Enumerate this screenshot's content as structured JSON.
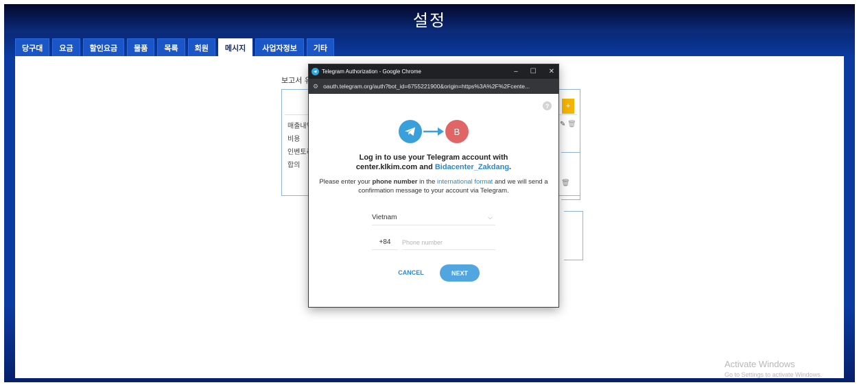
{
  "app": {
    "title": "설정",
    "tabs": [
      {
        "label": "당구대"
      },
      {
        "label": "요금"
      },
      {
        "label": "할인요금"
      },
      {
        "label": "물품"
      },
      {
        "label": "목록"
      },
      {
        "label": "회원"
      },
      {
        "label": "메시지",
        "active": true
      },
      {
        "label": "사업자정보"
      },
      {
        "label": "기타"
      }
    ]
  },
  "background_page": {
    "report_label": "보고서 유",
    "list_items": [
      "매출내역",
      "비용",
      "인벤토리",
      "합의"
    ],
    "add_button": "+",
    "edit_icon": "edit-icon",
    "trash_icon": "trash-icon"
  },
  "popup": {
    "window_title": "Telegram Authorization - Google Chrome",
    "url": "oauth.telegram.org/auth?bot_id=6755221900&origin=https%3A%2F%2Fcente...",
    "controls": {
      "minimize": "–",
      "maximize": "☐",
      "close": "✕"
    },
    "bot_initial": "B",
    "login_line1": "Log in to use your Telegram account with",
    "login_site": "center.klkim.com",
    "login_and": " and ",
    "login_bot": "Bidacenter_Zakdang",
    "login_period": ".",
    "desc_prefix": "Please enter your ",
    "desc_bold": "phone number",
    "desc_mid": " in the ",
    "desc_link": "international format",
    "desc_suffix": " and we will send a confirmation message to your account via Telegram.",
    "country": "Vietnam",
    "country_code": "+84",
    "phone_placeholder": "Phone number",
    "phone_value": "",
    "cancel_label": "CANCEL",
    "next_label": "NEXT",
    "help_label": "?"
  },
  "watermark": {
    "line1": "Activate Windows",
    "line2": "Go to Settings to activate Windows."
  },
  "colors": {
    "telegram_blue": "#3aa0d9",
    "bot_avatar": "#e06666",
    "tab_blue": "#1b56c6",
    "add_button": "#f5b400"
  }
}
